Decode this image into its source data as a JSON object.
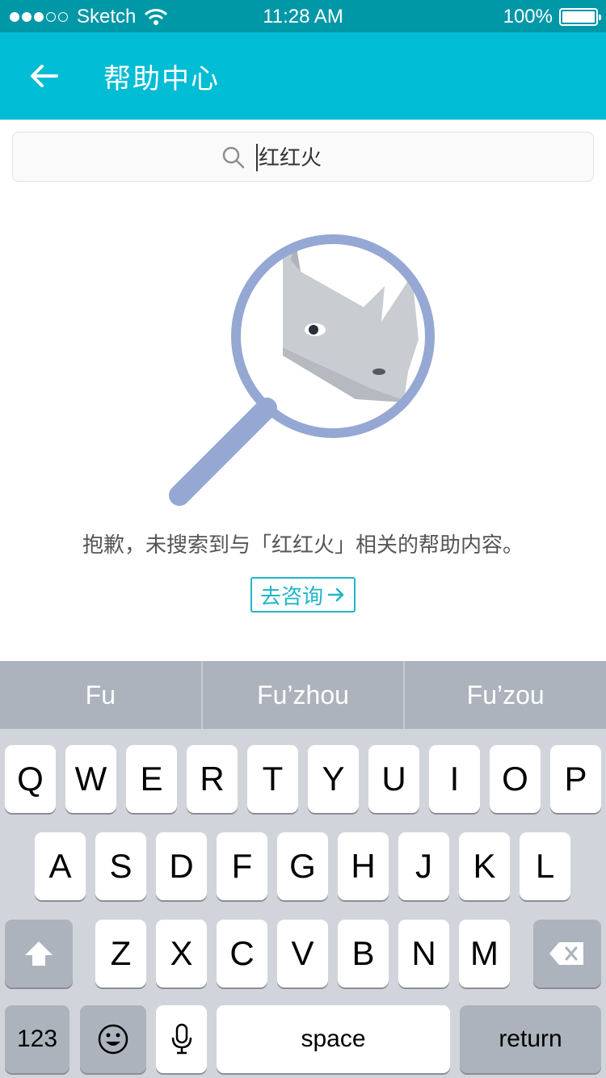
{
  "status_bar": {
    "carrier": "Sketch",
    "time": "11:28 AM",
    "battery": "100%"
  },
  "nav": {
    "title": "帮助中心"
  },
  "search": {
    "value": "红红火"
  },
  "result": {
    "message": "抱歉，未搜索到与「红红火」相关的帮助内容。",
    "consult_label": "去咨询"
  },
  "keyboard": {
    "suggestions": [
      "Fu",
      "Fu’zhou",
      "Fu’zou"
    ],
    "row1": [
      "Q",
      "W",
      "E",
      "R",
      "T",
      "Y",
      "U",
      "I",
      "O",
      "P"
    ],
    "row2": [
      "A",
      "S",
      "D",
      "F",
      "G",
      "H",
      "J",
      "K",
      "L"
    ],
    "row3": [
      "Z",
      "X",
      "C",
      "V",
      "B",
      "N",
      "M"
    ],
    "numbers_label": "123",
    "space_label": "space",
    "return_label": "return"
  },
  "colors": {
    "status_bar": "#0097a7",
    "nav_bar": "#00bcd4",
    "accent": "#1fb6c9"
  }
}
